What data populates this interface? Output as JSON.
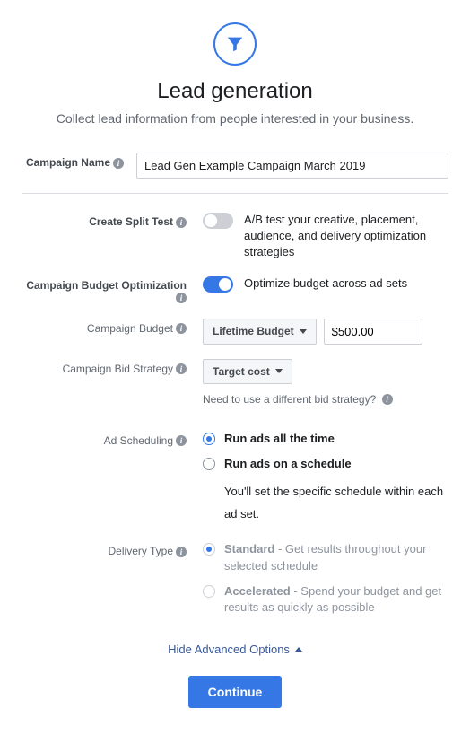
{
  "header": {
    "title": "Lead generation",
    "subtitle": "Collect lead information from people interested in your business."
  },
  "labels": {
    "campaign_name": "Campaign Name",
    "split_test": "Create Split Test",
    "budget_opt": "Campaign Budget Optimization",
    "campaign_budget": "Campaign Budget",
    "bid_strategy": "Campaign Bid Strategy",
    "ad_scheduling": "Ad Scheduling",
    "delivery_type": "Delivery Type"
  },
  "campaign_name_value": "Lead Gen Example Campaign March 2019",
  "split_test_desc": "A/B test your creative, placement, audience, and delivery optimization strategies",
  "budget_opt_desc": "Optimize budget across ad sets",
  "budget_type": "Lifetime Budget",
  "budget_value": "$500.00",
  "bid_value": "Target cost",
  "bid_helper": "Need to use a different bid strategy?",
  "scheduling": {
    "opt1": "Run ads all the time",
    "opt2": "Run ads on a schedule",
    "note": "You'll set the specific schedule within each ad set."
  },
  "delivery": {
    "opt1_title": "Standard",
    "opt1_desc": " - Get results throughout your selected schedule",
    "opt2_title": "Accelerated",
    "opt2_desc": " - Spend your budget and get results as quickly as possible"
  },
  "adv_toggle": "Hide Advanced Options",
  "continue": "Continue"
}
